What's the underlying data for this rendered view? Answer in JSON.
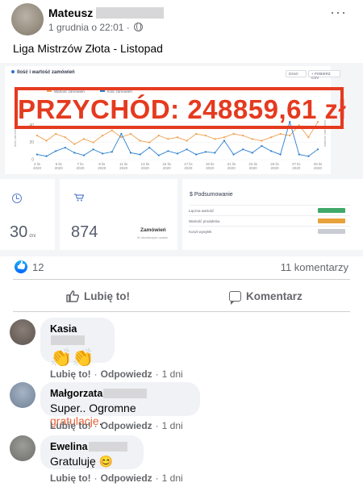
{
  "post": {
    "author": "Mateusz",
    "timestamp": "1 grudnia o 22:01",
    "separator": "·",
    "more_glyph": "···",
    "text": "Liga Mistrzów Złota - Listopad"
  },
  "image": {
    "chart_title": "Ilość i wartość zamówień",
    "period_select": "Dzień",
    "export_button": "+ POBIERZ CSV",
    "legend_orders": "Ilość zamówień",
    "legend_value": "Wartość zamówień",
    "y_left_label": "ilość zamówień",
    "y_right_label": "wartość zamówień",
    "revenue_banner": "PRZYCHÓD: 248859,61 zł",
    "days_value": "30",
    "days_unit": "dni",
    "orders_value": "874",
    "orders_label": "Zamówień",
    "orders_sub": "W określonym czasie",
    "summary_title": "$ Podsumowanie",
    "summary_rows": [
      {
        "label": "Łączna wartość",
        "color": "#3fa86a"
      },
      {
        "label": "Wartość produktów",
        "color": "#e8a23a"
      },
      {
        "label": "Koszt wysyłek",
        "color": "#c9ccd3"
      }
    ]
  },
  "chart_data": {
    "type": "line",
    "x": [
      "3 lis",
      "5 lis",
      "7 lis",
      "9 lis",
      "11 lis",
      "13 lis",
      "15 lis",
      "17 lis",
      "19 lis",
      "21 lis",
      "23 lis",
      "25 lis",
      "27 lis",
      "29 lis"
    ],
    "year_label": "2020",
    "ylim": [
      0,
      60
    ],
    "y_ticks": [
      0,
      20,
      40,
      60
    ],
    "series": [
      {
        "name": "Wartość zamówień",
        "color": "#f0a050",
        "values": [
          28,
          22,
          30,
          26,
          18,
          24,
          20,
          28,
          34,
          26,
          30,
          22,
          20,
          28,
          24,
          26,
          22,
          30,
          28,
          24,
          26,
          30,
          28,
          24,
          22,
          26,
          30,
          28,
          40,
          26,
          44
        ]
      },
      {
        "name": "Ilość zamówień",
        "color": "#2b7fd0",
        "values": [
          6,
          4,
          10,
          14,
          8,
          5,
          12,
          7,
          9,
          30,
          8,
          6,
          14,
          5,
          10,
          7,
          12,
          6,
          9,
          8,
          22,
          6,
          12,
          8,
          16,
          10,
          6,
          44,
          6,
          4,
          12
        ]
      }
    ]
  },
  "reactions": {
    "like_count": "12",
    "comments": "11 komentarzy"
  },
  "actions": {
    "like": "Lubię to!",
    "comment": "Komentarz"
  },
  "comments": [
    {
      "author": "Kasia",
      "text": "👏👏",
      "like": "Lubię to!",
      "reply": "Odpowiedz",
      "age": "1 dni"
    },
    {
      "author": "Małgorzata",
      "text_before": "Super.. Ogromne ",
      "text_highlight": "gratulacje",
      "text_after": ".",
      "like": "Lubię to!",
      "reply": "Odpowiedz",
      "age": "1 dni"
    },
    {
      "author": "Ewelina",
      "text": "Gratuluję 😊",
      "like": "Lubię to!",
      "reply": "Odpowiedz",
      "age": "1 dni"
    }
  ]
}
